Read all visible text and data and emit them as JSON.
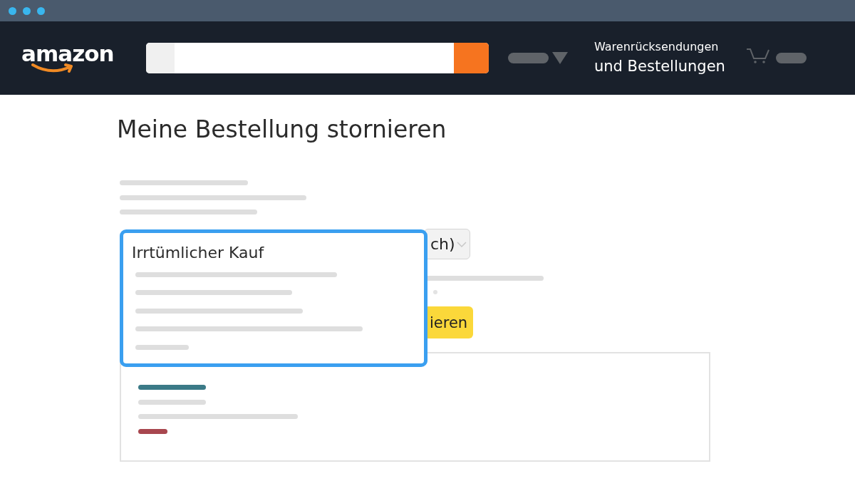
{
  "header": {
    "logo": "amazon",
    "returns_orders": {
      "line_1": "Warenrücksendungen",
      "line_2": "und Bestellungen"
    }
  },
  "page": {
    "title": "Meine Bestellung stornieren",
    "reason_select": {
      "value": "ch)"
    },
    "cancel_button": {
      "label": "ieren"
    }
  },
  "reason_dropdown": {
    "option": "Irrtümlicher Kauf"
  }
}
